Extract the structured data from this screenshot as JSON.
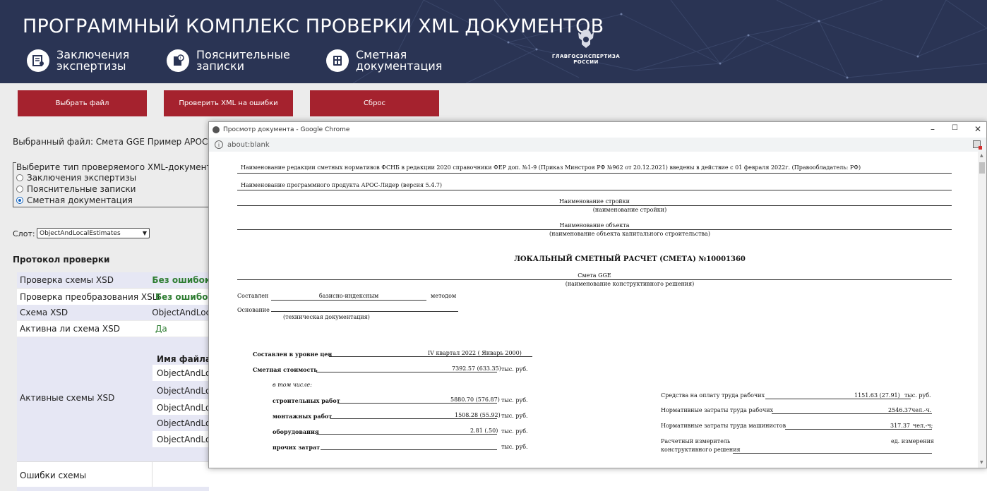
{
  "header": {
    "title": "ПРОГРАММНЫЙ КОМПЛЕКС ПРОВЕРКИ XML ДОКУМЕНТОВ",
    "nav": [
      {
        "label": "Заключения экспертизы",
        "icon": "certificate-icon"
      },
      {
        "label": "Пояснительные записки",
        "icon": "info-document-icon"
      },
      {
        "label": "Сметная документация",
        "icon": "calculator-icon"
      }
    ],
    "logo_text_1": "ГЛАВГОСЭКСПЕРТИЗА",
    "logo_text_2": "РОССИИ"
  },
  "toolbar": {
    "choose_file": "Выбрать файл",
    "validate": "Проверить XML на ошибки",
    "reset": "Сброс"
  },
  "form": {
    "selected_file": "Выбранный файл:  Смета GGE Пример АРОС (ЛС",
    "doc_type_legend": "Выберите тип проверяемого XML-документа:",
    "doc_types": [
      {
        "label": "Заключения экспертизы",
        "checked": false
      },
      {
        "label": "Пояснительные записки",
        "checked": false
      },
      {
        "label": "Сметная документация",
        "checked": true
      }
    ],
    "slot_label": "Слот:",
    "slot_value": "ObjectAndLocalEstimates"
  },
  "protocol": {
    "title": "Протокол проверки",
    "rows": [
      {
        "key": "Проверка схемы XSD",
        "value": "Без ошибок"
      },
      {
        "key": "Проверка преобразования XSLT",
        "value": "Без ошибок"
      },
      {
        "key": "Схема XSD",
        "value": "ObjectAndLoc"
      },
      {
        "key": "Активна ли схема XSD",
        "value": "Да"
      }
    ],
    "active_label": "Активные схемы XSD",
    "inner_header": "Имя файла с",
    "inner_rows": [
      "ObjectAndLoc",
      "ObjectAndLoc",
      "ObjectAndLoc",
      "ObjectAndLoc",
      "ObjectAndLoc"
    ],
    "errors_label": "Ошибки схемы"
  },
  "popup": {
    "title": "Просмотр документа - Google Chrome",
    "url": "about:blank",
    "controls": {
      "minimize": "–",
      "maximize": "☐",
      "close": "✕"
    }
  },
  "document": {
    "edition_line": "Наименование редакции сметных нормативов ФСНБ в редакции 2020 справочники ФЕР доп. №1-9 (Приказ Минстроя РФ №962 от 20.12.2021) введены в действие с 01 февраля 2022г. (Правообладатель: РФ)",
    "software_line": "Наименование программного продукта АРОС-Лидер (версия 5.4.7)",
    "construction_name": "Наименование стройки",
    "construction_caption": "(наименование стройки)",
    "object_name": "Наименование объекта",
    "object_caption": "(наименование объекта капитального строительства)",
    "heading": "ЛОКАЛЬНЫЙ СМЕТНЫЙ РАСЧЕТ (СМЕТА) №10001360",
    "estimate_name": "Смета GGE",
    "estimate_caption": "(наименование конструктивного решения)",
    "composed_label": "Составлен",
    "composed_value": "базисно-индексным",
    "method_label": "методом",
    "basis_label": "Основание",
    "basis_caption": "(техническая документация)",
    "price_level_label": "Составлен в уровне цен",
    "price_level_value": "IV квартал 2022 ( Январь 2000)",
    "cost_label": "Сметная стоимость",
    "cost_value": "7392.57 (633.35)",
    "unit_rub": "тыс. руб.",
    "including": "в том числе:",
    "items": [
      {
        "label": "строительных работ",
        "value": "5880.70 (576.87)"
      },
      {
        "label": "монтажных работ",
        "value": "1508.28 (55.92)"
      },
      {
        "label": "оборудования",
        "value": "2.81 (.50)"
      },
      {
        "label": "прочих затрат",
        "value": ""
      }
    ],
    "right_items": [
      {
        "label": "Средства на оплату труда рабочих",
        "value": "1151.63 (27.91)",
        "unit": "тыс. руб."
      },
      {
        "label": "Нормативные затраты труда рабочих",
        "value": "2546.37",
        "unit": "чел.-ч."
      },
      {
        "label": "Нормативные затраты труда машинистов",
        "value": "317.37",
        "unit": "чел.-ч;"
      }
    ],
    "meter_label_1": "Расчетный измеритель",
    "meter_label_2": "конструктивного решения",
    "meter_unit": "ед. измерения"
  }
}
